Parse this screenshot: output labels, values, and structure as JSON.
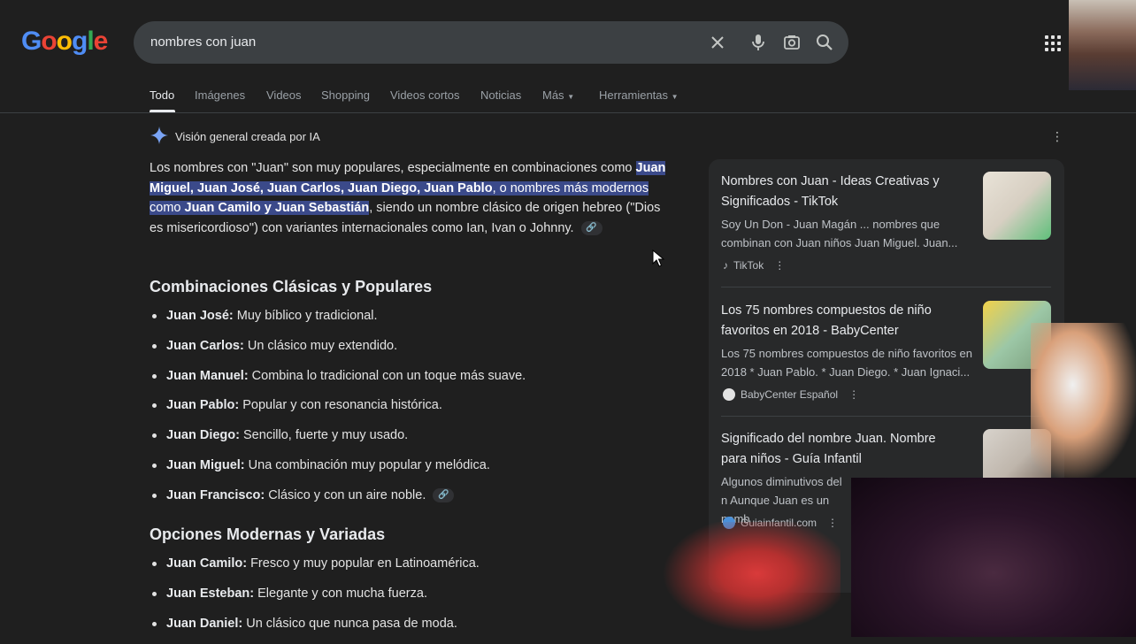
{
  "search": {
    "query": "nombres con juan"
  },
  "tabs": [
    {
      "label": "Todo"
    },
    {
      "label": "Imágenes"
    },
    {
      "label": "Videos"
    },
    {
      "label": "Shopping"
    },
    {
      "label": "Videos cortos"
    },
    {
      "label": "Noticias"
    },
    {
      "label": "Más"
    },
    {
      "label": "Herramientas"
    }
  ],
  "ai_overview": {
    "header": "Visión general creada por IA",
    "p_intro": "Los nombres con \"Juan\" son muy populares, especialmente en combinaciones como",
    "p_hl_bold1": "Juan Miguel, Juan José, Juan Carlos, Juan Diego, Juan Pablo",
    "p_hl_text1": ", o nombres más modernos como ",
    "p_hl_bold2": "Juan Camilo y Juan Sebastián",
    "p_rest": ", siendo un nombre clásico de origen hebreo (\"Dios es misericordioso\") con variantes internacionales como Ian, Ivan o Johnny.",
    "section1_title": "Combinaciones Clásicas y Populares",
    "section1": [
      {
        "name": "Juan José:",
        "desc": " Muy bíblico y tradicional."
      },
      {
        "name": "Juan Carlos:",
        "desc": " Un clásico muy extendido."
      },
      {
        "name": "Juan Manuel:",
        "desc": " Combina lo tradicional con un toque más suave."
      },
      {
        "name": "Juan Pablo:",
        "desc": " Popular y con resonancia histórica."
      },
      {
        "name": "Juan Diego:",
        "desc": " Sencillo, fuerte y muy usado."
      },
      {
        "name": "Juan Miguel:",
        "desc": " Una combinación muy popular y melódica."
      },
      {
        "name": "Juan Francisco:",
        "desc": " Clásico y con un aire noble."
      }
    ],
    "section2_title": "Opciones Modernas y Variadas",
    "section2": [
      {
        "name": "Juan Camilo:",
        "desc": " Fresco y muy popular en Latinoamérica."
      },
      {
        "name": "Juan Esteban:",
        "desc": " Elegante y con mucha fuerza."
      },
      {
        "name": "Juan Daniel:",
        "desc": " Un clásico que nunca pasa de moda."
      }
    ]
  },
  "cards": [
    {
      "title": "Nombres con Juan - Ideas Creativas y Significados - TikTok",
      "snippet": "Soy Un Don - Juan Magán ... nombres que combinan con Juan niños Juan Miguel. Juan...",
      "source": "TikTok"
    },
    {
      "title": "Los 75 nombres compuestos de niño favoritos en 2018 - BabyCenter",
      "snippet": "Los 75 nombres compuestos de niño favoritos en 2018 * Juan Pablo. * Juan Diego. * Juan Ignaci...",
      "source": "BabyCenter Español"
    },
    {
      "title": "Significado del nombre Juan. Nombre para niños - Guía Infantil",
      "snippet": "Algunos diminutivos del n Aunque Juan es un nomb",
      "source": "Guiainfantil.com"
    }
  ],
  "colors": {
    "background": "#1f1f1f",
    "highlight": "#3b4a8a",
    "search_bg": "#3c4043"
  }
}
